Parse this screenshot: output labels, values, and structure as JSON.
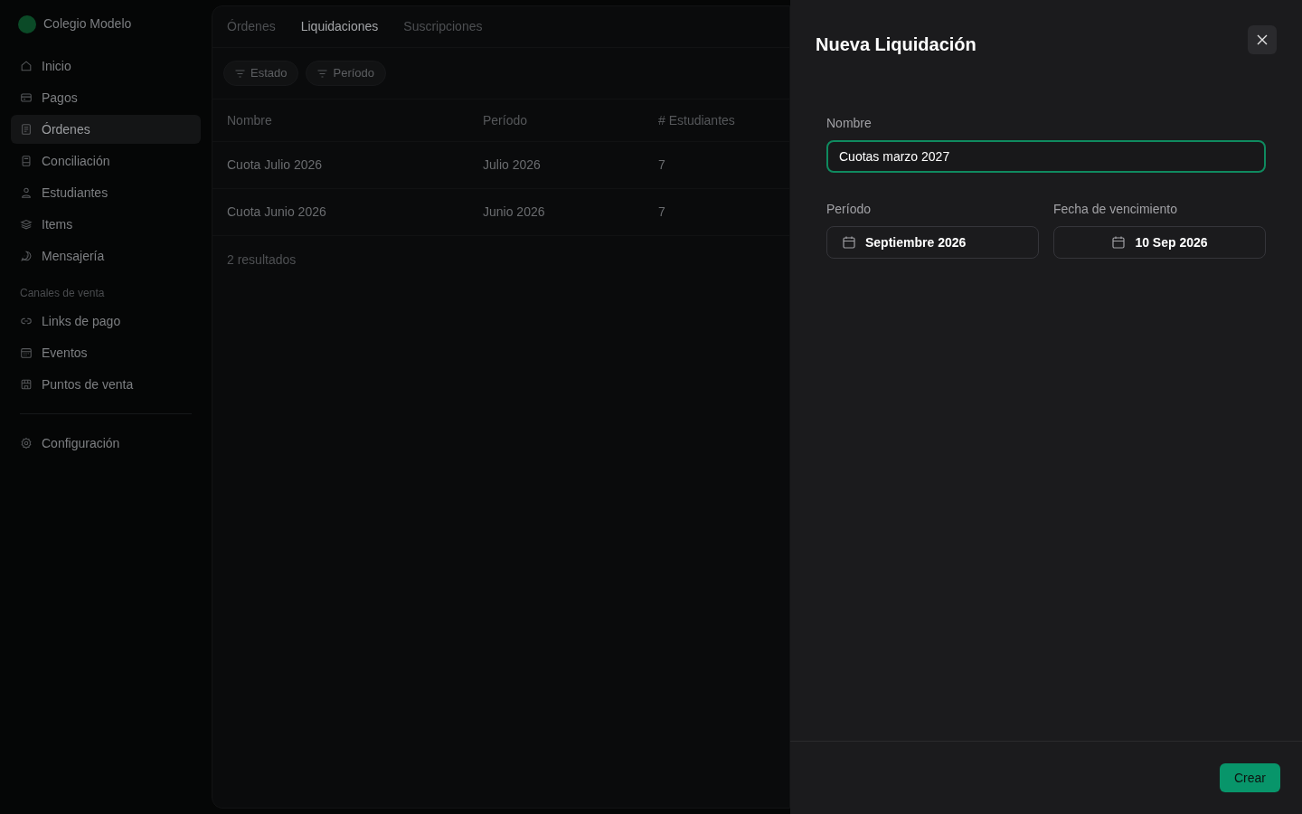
{
  "sidebar": {
    "brand": "Colegio Modelo",
    "items": [
      {
        "label": "Inicio",
        "selected": false
      },
      {
        "label": "Pagos",
        "selected": false
      },
      {
        "label": "Órdenes",
        "selected": true
      },
      {
        "label": "Conciliación",
        "selected": false
      },
      {
        "label": "Estudiantes",
        "selected": false
      },
      {
        "label": "Items",
        "selected": false
      },
      {
        "label": "Mensajería",
        "selected": false
      }
    ],
    "section_label": "Canales de venta",
    "channel_items": [
      {
        "label": "Links de pago",
        "selected": false
      },
      {
        "label": "Eventos",
        "selected": false
      },
      {
        "label": "Puntos de venta",
        "selected": false
      }
    ],
    "footer_items": [
      {
        "label": "Configuración",
        "selected": false
      }
    ]
  },
  "main": {
    "tabs": [
      {
        "label": "Órdenes",
        "selected": false
      },
      {
        "label": "Liquidaciones",
        "selected": true
      },
      {
        "label": "Suscripciones",
        "selected": false
      }
    ],
    "filters": [
      "Estado",
      "Período"
    ],
    "table": {
      "columns": [
        "Nombre",
        "Período",
        "# Estudiantes"
      ],
      "rows": [
        [
          "Cuota Julio 2026",
          "Julio 2026",
          "7"
        ],
        [
          "Cuota Junio 2026",
          "Junio 2026",
          "7"
        ]
      ]
    },
    "result_count": "2 resultados"
  },
  "dialog": {
    "title": "Nueva Liquidación",
    "name_field": {
      "label": "Nombre",
      "value": "Cuotas marzo 2027",
      "focused": true
    },
    "period_field": {
      "label": "Período",
      "value": "Septiembre 2026"
    },
    "due_date_field": {
      "label": "Fecha de vencimiento",
      "value": "10 Sep 2026"
    },
    "submit_button": "Crear"
  }
}
